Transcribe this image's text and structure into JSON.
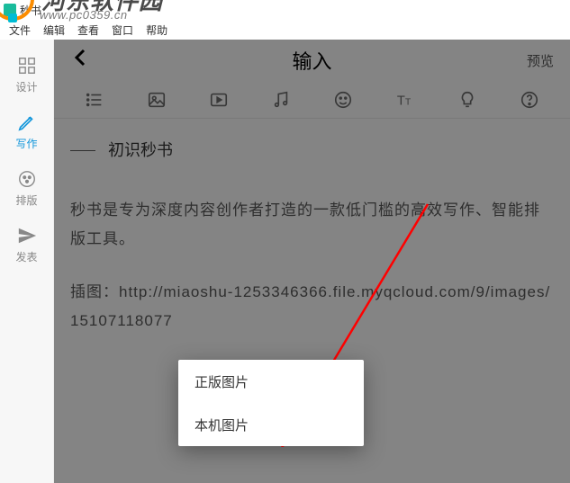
{
  "titlebar": {
    "app_name": "秒书"
  },
  "menubar": {
    "file": "文件",
    "edit": "编辑",
    "view": "查看",
    "window": "窗口",
    "help": "帮助"
  },
  "sidebar": {
    "design": "设计",
    "write": "写作",
    "layout": "排版",
    "publish": "发表"
  },
  "editor": {
    "header_title": "输入",
    "preview": "预览",
    "doc_title": "初识秒书",
    "paragraph1": "秒书是专为深度内容创作者打造的一款低门槛的高效写作、智能排版工具。",
    "paragraph2": "插图：http://miaoshu-1253346366.file.myqcloud.com/9/images/15107118077"
  },
  "popup": {
    "option1": "正版图片",
    "option2": "本机图片"
  },
  "watermark": {
    "name": "河东软件园",
    "domain": "www.pc0359.cn"
  }
}
